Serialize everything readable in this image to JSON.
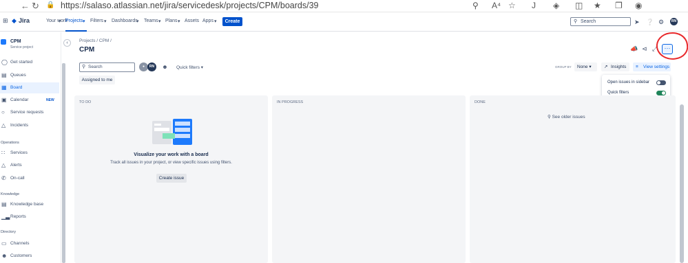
{
  "browser": {
    "url": "https://salaso.atlassian.net/jira/servicedesk/projects/CPM/boards/39",
    "back_icon": "back-arrow-icon",
    "refresh_icon": "refresh-icon"
  },
  "topnav": {
    "brand": "Jira",
    "items": [
      "Your work",
      "Projects",
      "Filters",
      "Dashboards",
      "Teams",
      "Plans",
      "Assets",
      "Apps"
    ],
    "create_label": "Create",
    "search_placeholder": "Search",
    "avatar_initials": "RN",
    "accent_color": "#0052cc"
  },
  "sidebar": {
    "project_name": "CPM",
    "project_type": "Service project",
    "items": [
      {
        "label": "Get started",
        "icon": "rocket-icon"
      },
      {
        "label": "Queues",
        "icon": "queue-icon"
      },
      {
        "label": "Board",
        "icon": "board-icon",
        "selected": true
      },
      {
        "label": "Calendar",
        "icon": "calendar-icon",
        "badge": "NEW"
      },
      {
        "label": "Service requests",
        "icon": "chat-icon"
      },
      {
        "label": "Incidents",
        "icon": "warning-icon"
      }
    ],
    "sections": [
      {
        "title": "Operations",
        "items": [
          {
            "label": "Services",
            "icon": "services-icon"
          },
          {
            "label": "Alerts",
            "icon": "alert-icon"
          },
          {
            "label": "On-call",
            "icon": "phone-icon"
          }
        ]
      },
      {
        "title": "Knowledge",
        "items": [
          {
            "label": "Knowledge base",
            "icon": "book-icon"
          },
          {
            "label": "Reports",
            "icon": "chart-icon"
          }
        ]
      },
      {
        "title": "Directory",
        "items": [
          {
            "label": "Channels",
            "icon": "monitor-icon"
          },
          {
            "label": "Customers",
            "icon": "people-icon"
          }
        ]
      }
    ]
  },
  "main": {
    "breadcrumb": "Projects  /  CPM  /",
    "title": "CPM",
    "search_placeholder": "Search",
    "avatar_initials": "RN",
    "quick_filters_label": "Quick filters",
    "assigned_label": "Assigned to me",
    "group_by_label": "GROUP BY",
    "group_by_value": "None",
    "insights_label": "Insights",
    "view_settings_label": "View settings",
    "more_label": "···",
    "view_settings_menu": [
      {
        "label": "Open issues in sidebar",
        "on": false
      },
      {
        "label": "Quick filters",
        "on": true
      }
    ],
    "columns": [
      {
        "title": "TO DO"
      },
      {
        "title": "IN PROGRESS"
      },
      {
        "title": "DONE"
      }
    ],
    "empty_title": "Visualize your work with a board",
    "empty_text": "Track all issues in your project, or view specific issues using filters.",
    "create_issue_label": "Create issue",
    "older_issues_label": "See older issues"
  }
}
